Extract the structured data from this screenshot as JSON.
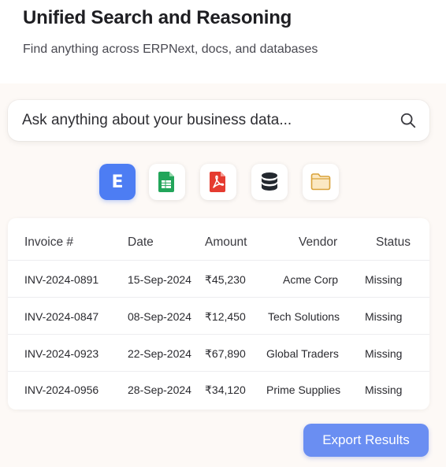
{
  "header": {
    "title": "Unified Search and Reasoning",
    "subtitle": "Find anything across ERPNext, docs, and databases"
  },
  "search": {
    "placeholder": "Ask anything about your business data...",
    "icon": "search-icon"
  },
  "sources": [
    {
      "name": "ERPNext",
      "icon": "erpnext-icon",
      "glyph": "E",
      "active": true,
      "color": "#4d7df3"
    },
    {
      "name": "Sheets",
      "icon": "spreadsheet-icon",
      "active": false,
      "color": "#22a55a"
    },
    {
      "name": "PDF",
      "icon": "pdf-icon",
      "active": false,
      "color": "#e53b30"
    },
    {
      "name": "Database",
      "icon": "database-icon",
      "active": false,
      "color": "#23282f"
    },
    {
      "name": "Folder",
      "icon": "folder-icon",
      "active": false,
      "color": "#d9a23a"
    }
  ],
  "table": {
    "headers": [
      "Invoice #",
      "Date",
      "Amount",
      "Vendor",
      "Status"
    ],
    "rows": [
      [
        "INV-2024-0891",
        "15-Sep-2024",
        "₹45,230",
        "Acme Corp",
        "Missing"
      ],
      [
        "INV-2024-0847",
        "08-Sep-2024",
        "₹12,450",
        "Tech Solutions",
        "Missing"
      ],
      [
        "INV-2024-0923",
        "22-Sep-2024",
        "₹67,890",
        "Global Traders",
        "Missing"
      ],
      [
        "INV-2024-0956",
        "28-Sep-2024",
        "₹34,120",
        "Prime Supplies",
        "Missing"
      ]
    ]
  },
  "actions": {
    "export_label": "Export Results"
  }
}
